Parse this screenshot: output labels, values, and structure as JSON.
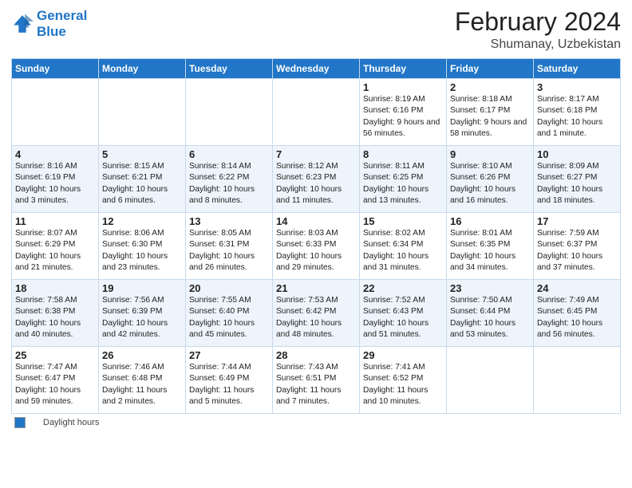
{
  "header": {
    "logo_line1": "General",
    "logo_line2": "Blue",
    "main_title": "February 2024",
    "sub_title": "Shumanay, Uzbekistan"
  },
  "days_of_week": [
    "Sunday",
    "Monday",
    "Tuesday",
    "Wednesday",
    "Thursday",
    "Friday",
    "Saturday"
  ],
  "weeks": [
    [
      {
        "day": "",
        "info": ""
      },
      {
        "day": "",
        "info": ""
      },
      {
        "day": "",
        "info": ""
      },
      {
        "day": "",
        "info": ""
      },
      {
        "day": "1",
        "info": "Sunrise: 8:19 AM\nSunset: 6:16 PM\nDaylight: 9 hours and 56 minutes."
      },
      {
        "day": "2",
        "info": "Sunrise: 8:18 AM\nSunset: 6:17 PM\nDaylight: 9 hours and 58 minutes."
      },
      {
        "day": "3",
        "info": "Sunrise: 8:17 AM\nSunset: 6:18 PM\nDaylight: 10 hours and 1 minute."
      }
    ],
    [
      {
        "day": "4",
        "info": "Sunrise: 8:16 AM\nSunset: 6:19 PM\nDaylight: 10 hours and 3 minutes."
      },
      {
        "day": "5",
        "info": "Sunrise: 8:15 AM\nSunset: 6:21 PM\nDaylight: 10 hours and 6 minutes."
      },
      {
        "day": "6",
        "info": "Sunrise: 8:14 AM\nSunset: 6:22 PM\nDaylight: 10 hours and 8 minutes."
      },
      {
        "day": "7",
        "info": "Sunrise: 8:12 AM\nSunset: 6:23 PM\nDaylight: 10 hours and 11 minutes."
      },
      {
        "day": "8",
        "info": "Sunrise: 8:11 AM\nSunset: 6:25 PM\nDaylight: 10 hours and 13 minutes."
      },
      {
        "day": "9",
        "info": "Sunrise: 8:10 AM\nSunset: 6:26 PM\nDaylight: 10 hours and 16 minutes."
      },
      {
        "day": "10",
        "info": "Sunrise: 8:09 AM\nSunset: 6:27 PM\nDaylight: 10 hours and 18 minutes."
      }
    ],
    [
      {
        "day": "11",
        "info": "Sunrise: 8:07 AM\nSunset: 6:29 PM\nDaylight: 10 hours and 21 minutes."
      },
      {
        "day": "12",
        "info": "Sunrise: 8:06 AM\nSunset: 6:30 PM\nDaylight: 10 hours and 23 minutes."
      },
      {
        "day": "13",
        "info": "Sunrise: 8:05 AM\nSunset: 6:31 PM\nDaylight: 10 hours and 26 minutes."
      },
      {
        "day": "14",
        "info": "Sunrise: 8:03 AM\nSunset: 6:33 PM\nDaylight: 10 hours and 29 minutes."
      },
      {
        "day": "15",
        "info": "Sunrise: 8:02 AM\nSunset: 6:34 PM\nDaylight: 10 hours and 31 minutes."
      },
      {
        "day": "16",
        "info": "Sunrise: 8:01 AM\nSunset: 6:35 PM\nDaylight: 10 hours and 34 minutes."
      },
      {
        "day": "17",
        "info": "Sunrise: 7:59 AM\nSunset: 6:37 PM\nDaylight: 10 hours and 37 minutes."
      }
    ],
    [
      {
        "day": "18",
        "info": "Sunrise: 7:58 AM\nSunset: 6:38 PM\nDaylight: 10 hours and 40 minutes."
      },
      {
        "day": "19",
        "info": "Sunrise: 7:56 AM\nSunset: 6:39 PM\nDaylight: 10 hours and 42 minutes."
      },
      {
        "day": "20",
        "info": "Sunrise: 7:55 AM\nSunset: 6:40 PM\nDaylight: 10 hours and 45 minutes."
      },
      {
        "day": "21",
        "info": "Sunrise: 7:53 AM\nSunset: 6:42 PM\nDaylight: 10 hours and 48 minutes."
      },
      {
        "day": "22",
        "info": "Sunrise: 7:52 AM\nSunset: 6:43 PM\nDaylight: 10 hours and 51 minutes."
      },
      {
        "day": "23",
        "info": "Sunrise: 7:50 AM\nSunset: 6:44 PM\nDaylight: 10 hours and 53 minutes."
      },
      {
        "day": "24",
        "info": "Sunrise: 7:49 AM\nSunset: 6:45 PM\nDaylight: 10 hours and 56 minutes."
      }
    ],
    [
      {
        "day": "25",
        "info": "Sunrise: 7:47 AM\nSunset: 6:47 PM\nDaylight: 10 hours and 59 minutes."
      },
      {
        "day": "26",
        "info": "Sunrise: 7:46 AM\nSunset: 6:48 PM\nDaylight: 11 hours and 2 minutes."
      },
      {
        "day": "27",
        "info": "Sunrise: 7:44 AM\nSunset: 6:49 PM\nDaylight: 11 hours and 5 minutes."
      },
      {
        "day": "28",
        "info": "Sunrise: 7:43 AM\nSunset: 6:51 PM\nDaylight: 11 hours and 7 minutes."
      },
      {
        "day": "29",
        "info": "Sunrise: 7:41 AM\nSunset: 6:52 PM\nDaylight: 11 hours and 10 minutes."
      },
      {
        "day": "",
        "info": ""
      },
      {
        "day": "",
        "info": ""
      }
    ]
  ],
  "footer": {
    "daylight_label": "Daylight hours"
  }
}
